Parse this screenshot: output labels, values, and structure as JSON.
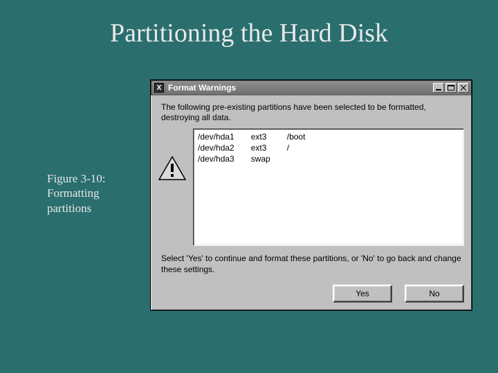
{
  "slide": {
    "title": "Partitioning the Hard Disk",
    "caption_line1": "Figure 3-10:",
    "caption_line2": "Formatting",
    "caption_line3": "partitions"
  },
  "dialog": {
    "app_icon_label": "X",
    "title": "Format Warnings",
    "message_top": "The following pre-existing partitions have been selected to be formatted, destroying all data.",
    "partitions": [
      {
        "device": "/dev/hda1",
        "fs": "ext3",
        "mount": "/boot"
      },
      {
        "device": "/dev/hda2",
        "fs": "ext3",
        "mount": "/"
      },
      {
        "device": "/dev/hda3",
        "fs": "swap",
        "mount": ""
      }
    ],
    "message_bottom": "Select 'Yes' to continue and format these partitions, or 'No' to go back and change these settings.",
    "buttons": {
      "yes": "Yes",
      "no": "No"
    }
  }
}
